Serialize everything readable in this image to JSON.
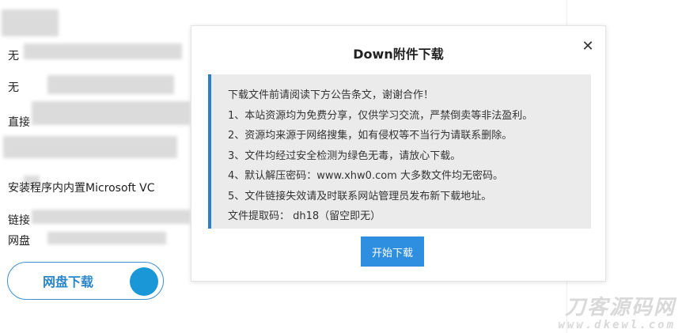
{
  "background": {
    "lines": [
      "无",
      "无",
      "直接",
      "",
      "安装程序内内置Microsoft VC",
      "链接",
      "网盘"
    ],
    "netdisk_button_label": "网盘下载",
    "accent_color": "#1a97d6"
  },
  "modal": {
    "title": "Down附件下载",
    "close_icon": "close-icon",
    "notice": {
      "lines": [
        "下载文件前请阅读下方公告条文，谢谢合作！",
        "1、本站资源均为免费分享，仅供学习交流，严禁倒卖等非法盈利。",
        "2、资源均来源于网络搜集，如有侵权等不当行为请联系删除。",
        "3、文件均经过安全检测为绿色无毒，请放心下载。",
        "4、默认解压密码：www.xhw0.com 大多数文件均无密码。",
        "5、文件链接失效请及时联系网站管理员发布新下载地址。",
        "文件提取码： dh18（留空即无）"
      ]
    },
    "start_button_label": "开始下载",
    "border_accent_color": "#2b7fcf",
    "button_color": "#2e8ee0"
  },
  "watermark": {
    "cn": "刀客源码网",
    "url": "www.dkewl.com"
  }
}
